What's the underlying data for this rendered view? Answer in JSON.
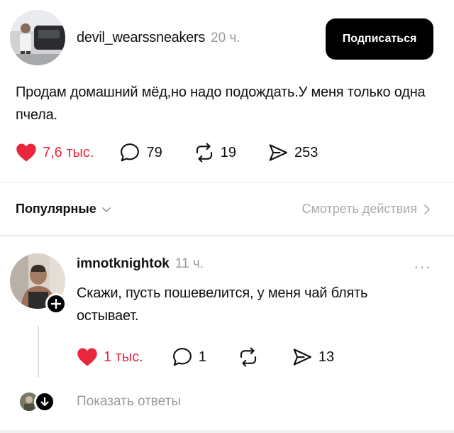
{
  "post": {
    "username": "devil_wearssneakers",
    "time": "20 ч.",
    "subscribe_label": "Подписаться",
    "text": "Продам домашний мёд,но надо подождать.У меня только одна пчела.",
    "likes": "7,6 тыс.",
    "comments": "79",
    "reposts": "19",
    "shares": "253"
  },
  "sort": {
    "label": "Популярные",
    "view_actions": "Смотреть действия"
  },
  "comment": {
    "username": "imnotknightok",
    "time": "11 ч.",
    "more": "···",
    "text": "Скажи, пусть пошевелится, у меня чай блять остывает.",
    "likes": "1 тыс.",
    "comments": "1",
    "shares": "13",
    "show_replies": "Показать ответы"
  },
  "colors": {
    "like_red": "#e8263c",
    "muted": "#9b9b9b",
    "button_black": "#000000"
  },
  "icons": [
    "heart-filled-icon",
    "comment-bubble-icon",
    "repost-icon",
    "share-arrow-icon",
    "chevron-down-icon",
    "chevron-right-icon",
    "plus-icon",
    "arrow-down-icon"
  ]
}
